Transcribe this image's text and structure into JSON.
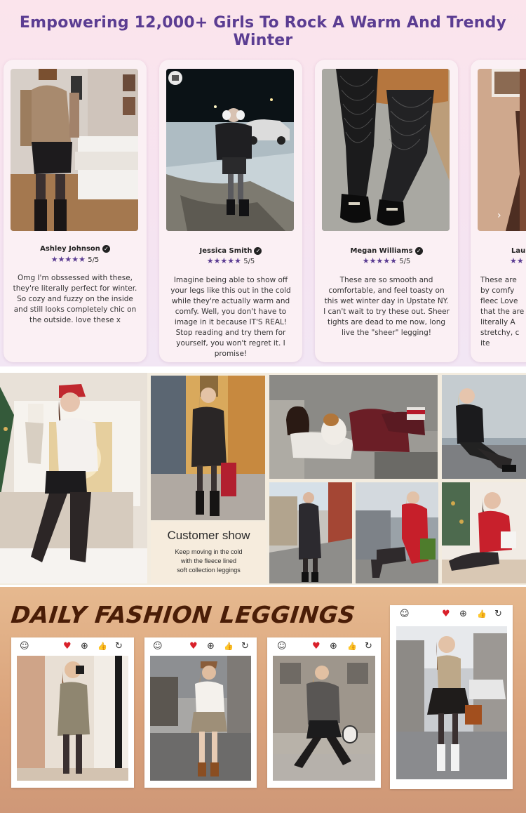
{
  "reviews": {
    "title": "Empowering 12,000+ Girls To Rock A Warm And Trendy Winter",
    "items": [
      {
        "name": "Ashley Johnson",
        "stars": "★★★★★",
        "score": "5/5",
        "text": "Omg I'm obssessed with these, they're literally perfect for winter. So cozy and fuzzy on the inside and still looks completely chic on the outside. love these x"
      },
      {
        "name": "Jessica Smith",
        "stars": "★★★★★",
        "score": "5/5",
        "text": "Imagine being able to show off your legs like this out in the cold while they're actually warm and comfy. Well, you don't have to image in it because IT'S REAL! Stop reading and try them for yourself, you won't regret it. I promise!"
      },
      {
        "name": "Megan Williams",
        "stars": "★★★★★",
        "score": "5/5",
        "text": "These are so smooth and comfortable, and feel toasty on this wet winter day in Upstate NY. I can't wait to try these out. Sheer tights are dead to me now, long live the \"sheer\" legging!"
      },
      {
        "name": "Laur",
        "stars": "★★",
        "score": "",
        "text": "These are by comfy fleec Love that the are literally A stretchy, c ite"
      }
    ],
    "next_arrow": "›"
  },
  "collage": {
    "customer_title": "Customer show",
    "customer_sub_1": "Keep moving in the cold",
    "customer_sub_2": "with the fleece lined",
    "customer_sub_3": "soft collection leggings"
  },
  "daily": {
    "title": "DAILY FASHION LEGGINGS",
    "icons": {
      "profile": "☺",
      "heart": "♥",
      "add": "⊕",
      "like": "👍",
      "share": "↻"
    }
  },
  "colors": {
    "title_purple": "#5b3d92",
    "star_purple": "#5b3d92",
    "heart_red": "#d9202a",
    "daily_title_brown": "#4a1d07"
  }
}
